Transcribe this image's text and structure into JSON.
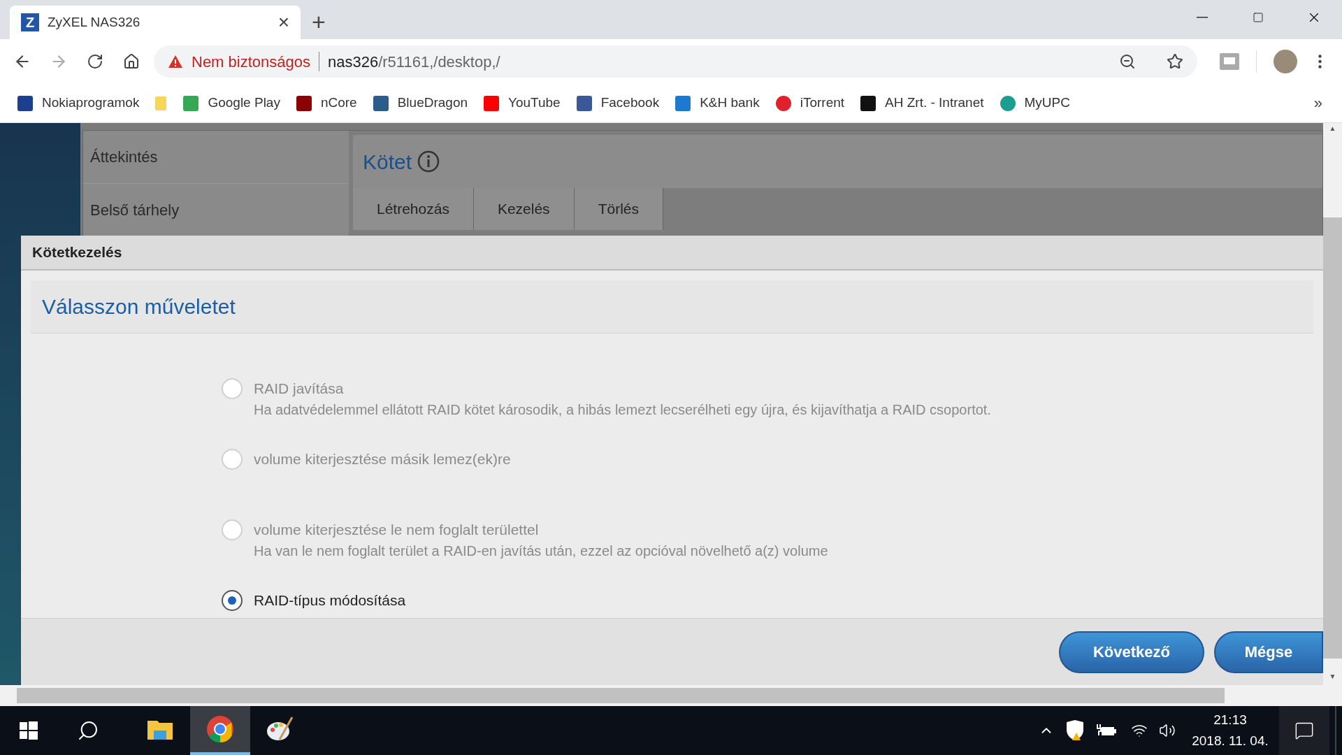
{
  "browser": {
    "tab": {
      "favicon_letter": "Z",
      "title": "ZyXEL NAS326",
      "close": "×",
      "new_tab": "+"
    },
    "address": {
      "security_label": "Nem biztonságos",
      "host": "nas326",
      "path": "/r51161,/desktop,/"
    },
    "bookmarks": [
      {
        "label": "Nokiaprogramok"
      },
      {
        "kind": "folder"
      },
      {
        "label": "Google Play"
      },
      {
        "label": "nCore"
      },
      {
        "label": "BlueDragon"
      },
      {
        "label": "YouTube"
      },
      {
        "label": "Facebook"
      },
      {
        "label": "K&H bank"
      },
      {
        "label": "iTorrent"
      },
      {
        "label": "AH Zrt. - Intranet"
      },
      {
        "label": "MyUPC"
      }
    ],
    "bookmarks_more": "»"
  },
  "scroll_arrows": {
    "up": "▲",
    "down": "▼"
  },
  "app": {
    "sidebar": [
      {
        "label": "Áttekintés"
      },
      {
        "label": "Belső tárhely"
      }
    ],
    "section_title": "Kötet",
    "tabs": [
      {
        "label": "Létrehozás",
        "selected": false
      },
      {
        "label": "Kezelés",
        "selected": false
      },
      {
        "label": "Törlés",
        "selected": false
      }
    ]
  },
  "dialog": {
    "title": "Kötetkezelés",
    "heading": "Válasszon műveletet",
    "options": [
      {
        "title": "RAID javítása",
        "description": "Ha adatvédelemmel ellátott RAID kötet károsodik, a hibás lemezt lecserélheti egy újra, és kijavíthatja a RAID csoportot.",
        "disabled": true,
        "selected": false
      },
      {
        "title": "volume kiterjesztése másik lemez(ek)re",
        "disabled": true,
        "selected": false
      },
      {
        "title": "volume kiterjesztése le nem foglalt területtel",
        "description": "Ha van le nem foglalt terület a RAID-en javítás után, ezzel az opcióval növelhető a(z) volume",
        "disabled": true,
        "selected": false
      },
      {
        "title": "RAID-típus módosítása",
        "disabled": false,
        "selected": true
      }
    ],
    "buttons": [
      "Következő",
      "Mégse"
    ]
  },
  "taskbar": {
    "apps": [
      {
        "kind": "folder",
        "selected": false
      },
      {
        "kind": "chrome",
        "selected": true
      },
      {
        "kind": "paint",
        "selected": false
      }
    ],
    "time": "21:13",
    "date": "2018. 11. 04."
  }
}
